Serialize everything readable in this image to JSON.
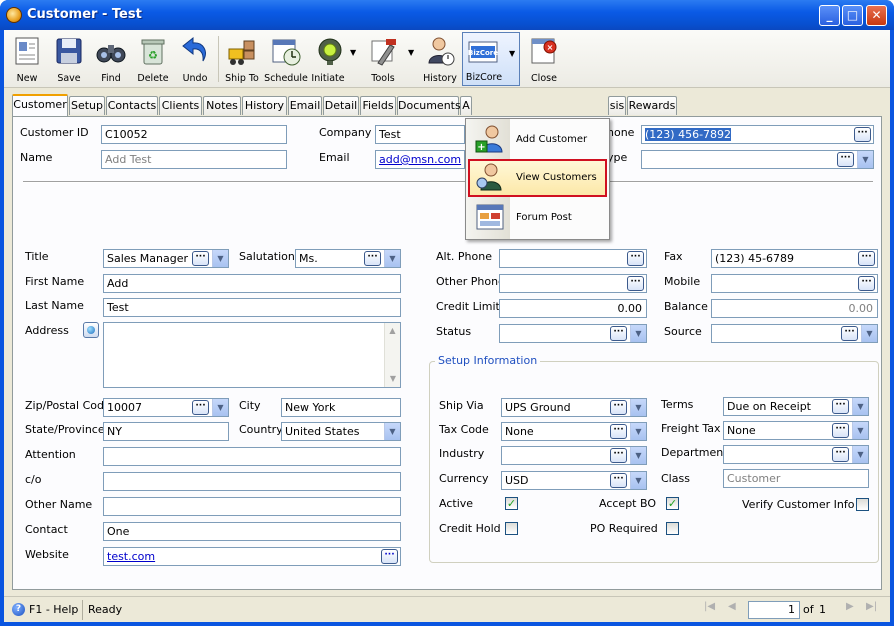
{
  "window": {
    "title": "Customer - Test"
  },
  "toolbar": {
    "new": "New",
    "save": "Save",
    "find": "Find",
    "delete": "Delete",
    "undo": "Undo",
    "ship_to": "Ship To",
    "schedule": "Schedule",
    "initiate": "Initiate",
    "tools": "Tools",
    "history": "History",
    "bizcore": "BizCore",
    "close": "Close"
  },
  "tabs": [
    "Customer",
    "Setup",
    "Contacts",
    "Clients",
    "Notes",
    "History",
    "Email",
    "Detail",
    "Fields",
    "Documents",
    "A",
    "sis",
    "Rewards"
  ],
  "bizcore_menu": {
    "add_customer": "Add Customer",
    "view_customers": "View Customers",
    "forum_post": "Forum Post"
  },
  "header": {
    "customer_id_label": "Customer ID",
    "customer_id_value": "C10052",
    "name_label": "Name",
    "name_placeholder": "Add Test",
    "company_label": "Company",
    "company_value": "Test",
    "email_label": "Email",
    "email_value": "add@msn.com",
    "phone_label": "hone",
    "phone_value": "(123) 456-7892",
    "type_label": "ype"
  },
  "left": {
    "title_label": "Title",
    "title_value": "Sales Manager",
    "salutation_label": "Salutation",
    "salutation_value": "Ms.",
    "first_name_label": "First Name",
    "first_name_value": "Add",
    "last_name_label": "Last Name",
    "last_name_value": "Test",
    "address_label": "Address",
    "zip_label": "Zip/Postal Code",
    "zip_value": "10007",
    "city_label": "City",
    "city_value": "New York",
    "state_label": "State/Province",
    "state_value": "NY",
    "country_label": "Country",
    "country_value": "United States",
    "attention_label": "Attention",
    "co_label": "c/o",
    "other_name_label": "Other Name",
    "contact_label": "Contact",
    "contact_value": "One",
    "website_label": "Website",
    "website_value": "test.com"
  },
  "right": {
    "alt_phone_label": "Alt. Phone",
    "fax_label": "Fax",
    "fax_value": "(123) 45-6789",
    "other_phone_label": "Other Phone",
    "mobile_label": "Mobile",
    "credit_limit_label": "Credit Limit",
    "credit_limit_value": "0.00",
    "balance_label": "Balance",
    "balance_value": "0.00",
    "status_label": "Status",
    "source_label": "Source"
  },
  "setup_info": {
    "title": "Setup Information",
    "ship_via_label": "Ship Via",
    "ship_via_value": "UPS Ground",
    "terms_label": "Terms",
    "terms_value": "Due on Receipt",
    "tax_code_label": "Tax Code",
    "tax_code_value": "None",
    "freight_tax_label": "Freight Tax",
    "freight_tax_value": "None",
    "industry_label": "Industry",
    "department_label": "Department",
    "currency_label": "Currency",
    "currency_value": "USD",
    "class_label": "Class",
    "class_value": "Customer",
    "active_label": "Active",
    "accept_bo_label": "Accept BO",
    "verify_label": "Verify Customer Info",
    "credit_hold_label": "Credit Hold",
    "po_required_label": "PO Required"
  },
  "status": {
    "help": "F1 - Help",
    "ready": "Ready",
    "page": "1",
    "of": "of",
    "total": "1"
  }
}
